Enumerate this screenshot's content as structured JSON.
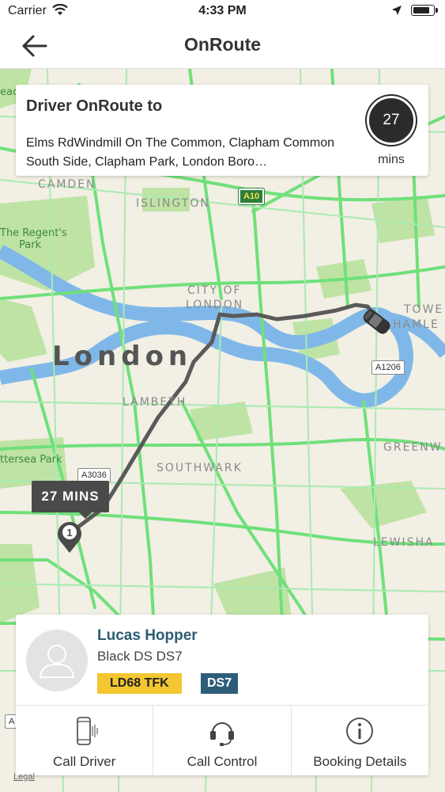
{
  "status_bar": {
    "carrier": "Carrier",
    "time": "4:33 PM"
  },
  "nav": {
    "title": "OnRoute"
  },
  "destination": {
    "heading": "Driver OnRoute to",
    "address": "Elms RdWindmill On The Common, Clapham Common South Side, Clapham Park, London Boro…",
    "eta_value": "27",
    "eta_unit": "mins"
  },
  "map": {
    "labels": {
      "camden": "CAMDEN",
      "islington": "ISLINGTON",
      "city_of": "CITY OF",
      "london_small": "LONDON",
      "london_big": "London",
      "lambeth": "LAMBETH",
      "southwark": "SOUTHWARK",
      "tower": "TOWE",
      "hamlets": "HAMLE",
      "greenwich": "GREENW",
      "lewisham": "LEWISHA",
      "regents_park_1": "The Regent's",
      "regents_park_2": "Park",
      "battersea_park": "ttersea Park",
      "lead": "ead"
    },
    "shields": {
      "a10": "A10",
      "a1206": "A1206",
      "a3036": "A3036",
      "a_left": "A"
    },
    "route_eta_label": "27 MINS",
    "pin_number": "1",
    "legal": "Legal"
  },
  "driver": {
    "name": "Lucas Hopper",
    "vehicle": "Black DS DS7",
    "plate": "LD68 TFK",
    "model": "DS7"
  },
  "actions": {
    "call_driver": "Call Driver",
    "call_control": "Call Control",
    "booking_details": "Booking Details"
  },
  "icons": [
    "wifi-icon",
    "location-arrow-icon",
    "battery-icon",
    "back-arrow-icon",
    "car-icon",
    "map-pin-icon",
    "avatar-placeholder-icon",
    "phone-icon",
    "headset-icon",
    "info-icon"
  ],
  "colors": {
    "driver_name": "#2a5e73",
    "plate_bg": "#f3c632",
    "model_bg": "#2e5d7a",
    "route": "#555555",
    "roads": "#6fe07a",
    "river": "#7fb8e8"
  }
}
